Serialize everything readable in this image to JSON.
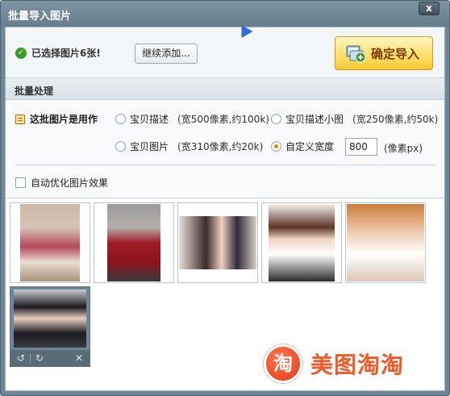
{
  "window": {
    "title": "批量导入图片",
    "close_label": "x"
  },
  "top": {
    "status_text": "已选择图片6张!",
    "continue_label": "继续添加...",
    "import_label": "确定导入"
  },
  "section": {
    "title": "批量处理"
  },
  "processing": {
    "use_label": "这批图片是用作",
    "options": [
      {
        "label": "宝贝描述",
        "extra": "(宽500像素,约100k)",
        "checked": false
      },
      {
        "label": "宝贝描述小图",
        "extra": "(宽250像素,约50k)",
        "checked": false
      },
      {
        "label": "宝贝图片",
        "extra": "(宽310像素,约20k)",
        "checked": false
      },
      {
        "label": "自定义宽度",
        "extra": "",
        "checked": true
      }
    ],
    "custom_width_value": "800",
    "unit_label": "(像素px)",
    "auto_optimize_label": "自动优化图片效果"
  },
  "gallery": {
    "count": 6,
    "toolbar_icons": [
      "rotate-left-icon",
      "rotate-right-icon",
      "delete-icon"
    ]
  },
  "watermark": {
    "logo_char": "淘",
    "text": "美图淘淘"
  },
  "colors": {
    "title_bar": "#6f8694",
    "import_button": "#ffe070",
    "accent_orange": "#f05a28",
    "check_green": "#3d9b2a"
  }
}
